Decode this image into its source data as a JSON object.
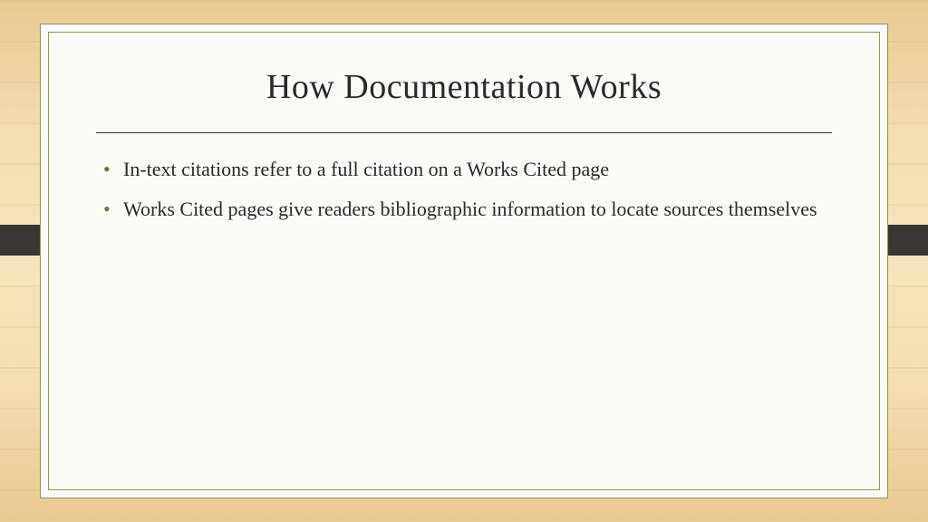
{
  "slide": {
    "title": "How Documentation Works",
    "bullets": [
      "In-text citations refer to a full citation on a Works Cited page",
      "Works Cited pages give readers bibliographic information to locate sources themselves"
    ]
  }
}
